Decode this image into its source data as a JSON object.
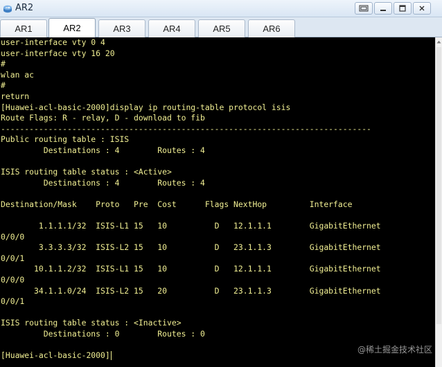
{
  "window": {
    "title": "AR2",
    "icon": "router-icon",
    "controls": [
      "restore-icon",
      "minimize-icon",
      "maximize-icon",
      "close-icon"
    ]
  },
  "tabs": [
    {
      "label": "AR1",
      "active": false
    },
    {
      "label": "AR2",
      "active": true
    },
    {
      "label": "AR3",
      "active": false
    },
    {
      "label": "AR4",
      "active": false
    },
    {
      "label": "AR5",
      "active": false
    },
    {
      "label": "AR6",
      "active": false
    }
  ],
  "terminal": {
    "text_color": "#f1ef93",
    "background": "#000000",
    "lines": [
      "user-interface vty 0 4",
      "user-interface vty 16 20",
      "#",
      "wlan ac",
      "#",
      "return",
      "[Huawei-acl-basic-2000]display ip routing-table protocol isis",
      "Route Flags: R - relay, D - download to fib",
      "------------------------------------------------------------------------------",
      "Public routing table : ISIS",
      "         Destinations : 4        Routes : 4",
      "",
      "ISIS routing table status : <Active>",
      "         Destinations : 4        Routes : 4",
      "",
      "Destination/Mask    Proto   Pre  Cost      Flags NextHop         Interface",
      "",
      "        1.1.1.1/32  ISIS-L1 15   10          D   12.1.1.1        GigabitEthernet",
      "0/0/0",
      "        3.3.3.3/32  ISIS-L2 15   10          D   23.1.1.3        GigabitEthernet",
      "0/0/1",
      "       10.1.1.2/32  ISIS-L1 15   10          D   12.1.1.1        GigabitEthernet",
      "0/0/0",
      "       34.1.1.0/24  ISIS-L2 15   20          D   23.1.1.3        GigabitEthernet",
      "0/0/1",
      "",
      "ISIS routing table status : <Inactive>",
      "         Destinations : 0        Routes : 0",
      "",
      "[Huawei-acl-basic-2000]"
    ]
  },
  "watermark": "@稀土掘金技术社区"
}
